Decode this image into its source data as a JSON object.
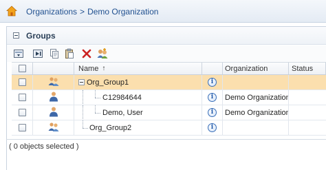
{
  "breadcrumb": {
    "items": [
      "Organizations",
      "Demo Organization"
    ],
    "separator": ">"
  },
  "panel": {
    "title": "Groups"
  },
  "toolbar": {
    "buttons": [
      "toggle-view-icon",
      "expand-icon",
      "copy-icon",
      "paste-icon",
      "delete-icon",
      "add-group-icon"
    ]
  },
  "table": {
    "columns": {
      "name": "Name",
      "name_sort": "↑",
      "organization": "Organization",
      "status": "Status"
    },
    "rows": [
      {
        "name": "Org_Group1",
        "organization": "",
        "status": "",
        "type": "group",
        "selected": true,
        "expanded": true
      },
      {
        "name": "C12984644",
        "organization": "Demo Organization",
        "status": "",
        "type": "user",
        "selected": false
      },
      {
        "name": "Demo, User",
        "organization": "Demo Organization",
        "status": "",
        "type": "user",
        "selected": false
      },
      {
        "name": "Org_Group2",
        "organization": "",
        "status": "",
        "type": "group",
        "selected": false
      }
    ]
  },
  "footer": {
    "status": "( 0 objects selected )"
  },
  "colors": {
    "selected_row": "#fbdfae",
    "link": "#1f4f8f",
    "delete": "#cc2222"
  }
}
